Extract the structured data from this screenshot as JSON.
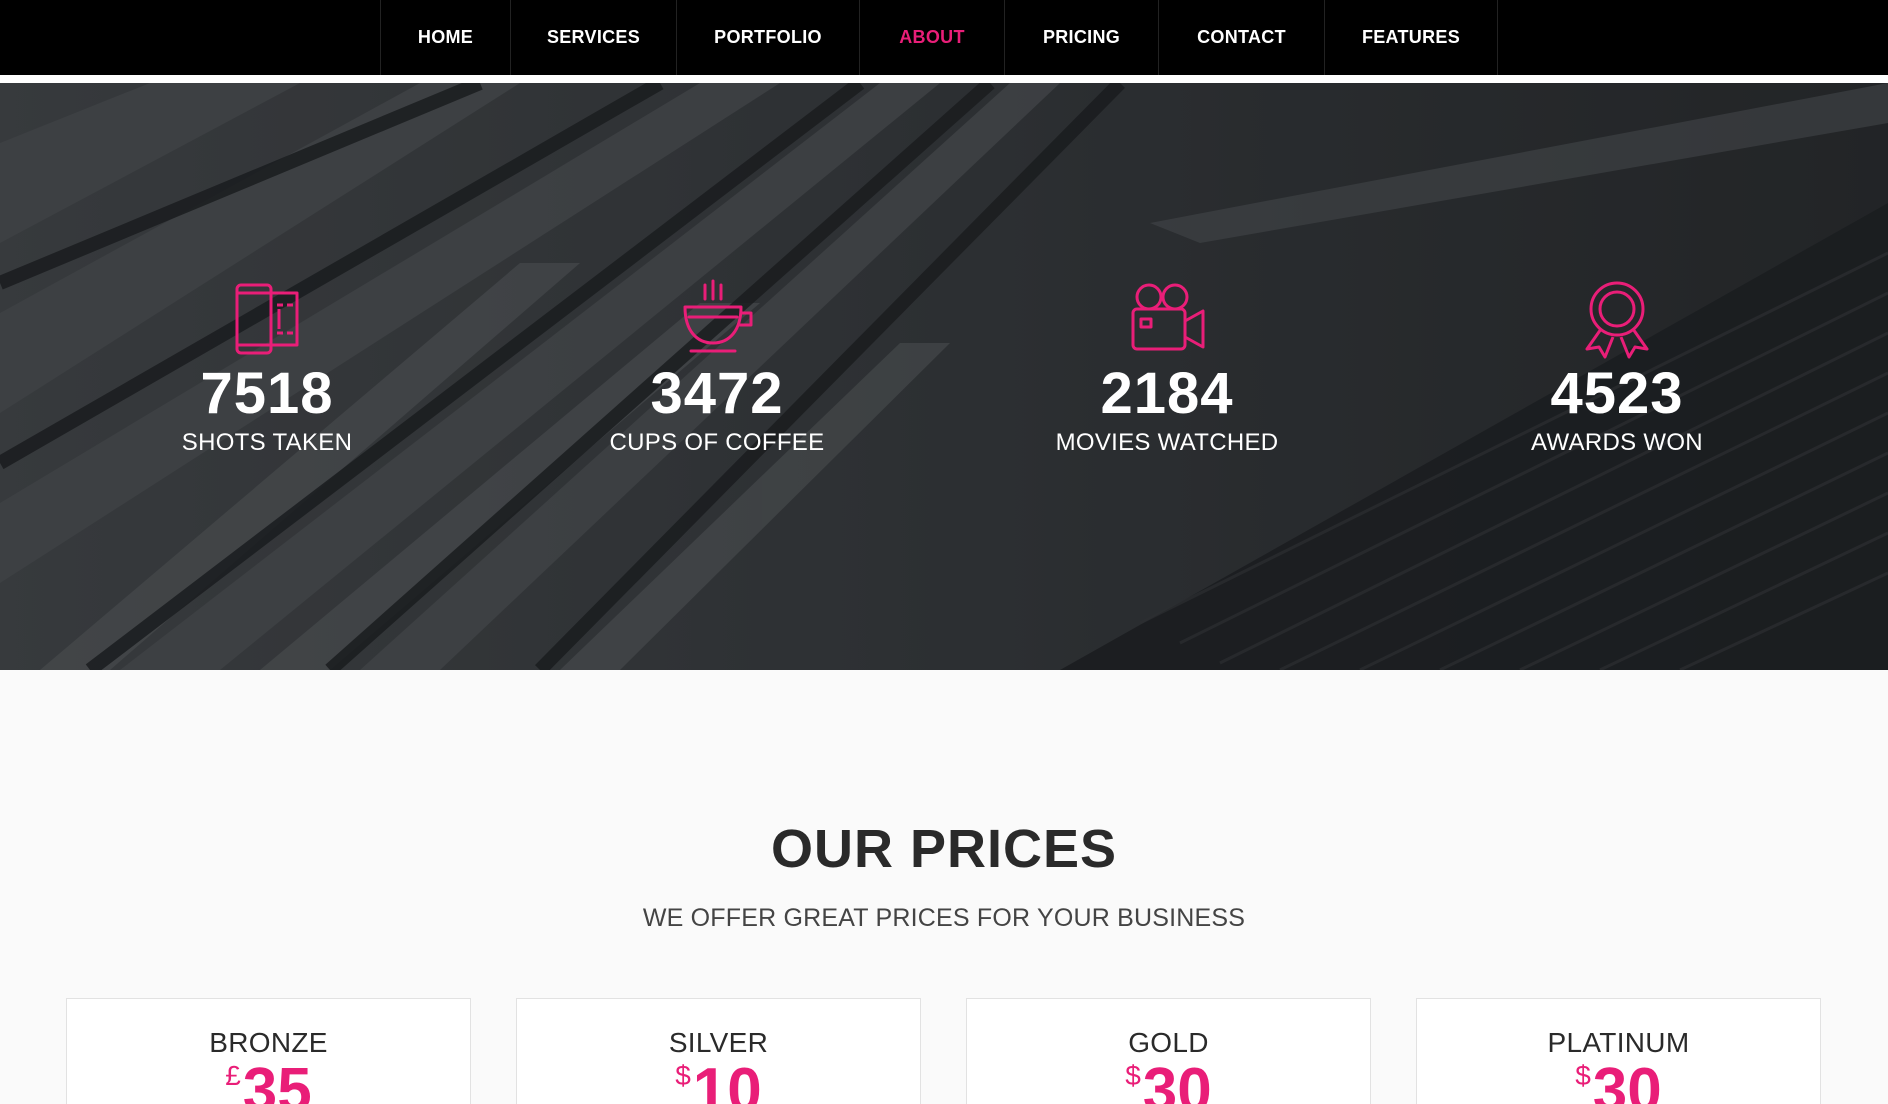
{
  "nav": {
    "items": [
      {
        "label": "HOME"
      },
      {
        "label": "SERVICES"
      },
      {
        "label": "PORTFOLIO"
      },
      {
        "label": "ABOUT",
        "active": true
      },
      {
        "label": "PRICING"
      },
      {
        "label": "CONTACT"
      },
      {
        "label": "FEATURES"
      }
    ]
  },
  "colors": {
    "accent": "#e91e78",
    "nav_bg": "#000000",
    "hero_bg": "#2b2e31"
  },
  "counters": [
    {
      "icon": "film-strip-icon",
      "value": "7518",
      "label": "SHOTS TAKEN"
    },
    {
      "icon": "coffee-cup-icon",
      "value": "3472",
      "label": "CUPS OF COFFEE"
    },
    {
      "icon": "video-camera-icon",
      "value": "2184",
      "label": "MOVIES WATCHED"
    },
    {
      "icon": "award-ribbon-icon",
      "value": "4523",
      "label": "AWARDS WON"
    }
  ],
  "pricing": {
    "title": "OUR PRICES",
    "subtitle": "WE OFFER GREAT PRICES FOR YOUR BUSINESS",
    "plans": [
      {
        "name": "BRONZE",
        "currency": "£",
        "amount": "35"
      },
      {
        "name": "SILVER",
        "currency": "$",
        "amount": "10"
      },
      {
        "name": "GOLD",
        "currency": "$",
        "amount": "30"
      },
      {
        "name": "PLATINUM",
        "currency": "$",
        "amount": "30"
      }
    ]
  }
}
